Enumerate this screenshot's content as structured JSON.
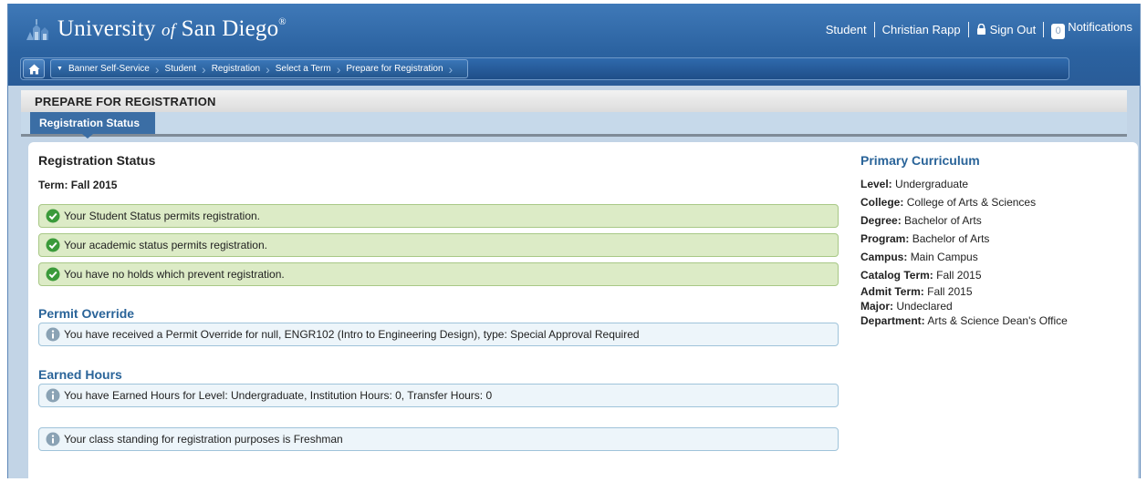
{
  "header": {
    "logo_prefix": "University",
    "logo_of": "of",
    "logo_suffix": "San Diego",
    "logo_reg": "®",
    "user_role": "Student",
    "user_name": "Christian Rapp",
    "sign_out": "Sign Out",
    "notifications_count": "0",
    "notifications_label": "Notifications"
  },
  "breadcrumbs": [
    "Banner Self-Service",
    "Student",
    "Registration",
    "Select a Term",
    "Prepare for Registration"
  ],
  "page": {
    "title": "PREPARE FOR REGISTRATION",
    "tab": "Registration Status"
  },
  "status": {
    "heading": "Registration Status",
    "term": "Term: Fall 2015",
    "messages": [
      "Your Student Status permits registration.",
      "Your academic status permits registration.",
      "You have no holds which prevent registration."
    ]
  },
  "permit": {
    "heading": "Permit Override",
    "message": "You have received a Permit Override for null, ENGR102 (Intro to Engineering Design), type: Special Approval Required"
  },
  "earned": {
    "heading": "Earned Hours",
    "message": "You have Earned Hours for Level: Undergraduate, Institution Hours: 0, Transfer Hours: 0",
    "standing": "Your class standing for registration purposes is Freshman"
  },
  "curriculum": {
    "heading": "Primary Curriculum",
    "rows": [
      {
        "label": "Level:",
        "value": "Undergraduate"
      },
      {
        "label": "College:",
        "value": "College of Arts & Sciences"
      },
      {
        "label": "Degree:",
        "value": "Bachelor of Arts"
      },
      {
        "label": "Program:",
        "value": "Bachelor of Arts"
      },
      {
        "label": "Campus:",
        "value": "Main Campus"
      },
      {
        "label": "Catalog Term:",
        "value": "Fall 2015"
      },
      {
        "label": "Admit Term:",
        "value": "Fall 2015"
      },
      {
        "label": "Major:",
        "value": "Undeclared"
      },
      {
        "label": "Department:",
        "value": "Arts & Science Dean's Office"
      }
    ]
  },
  "colors": {
    "header_blue": "#2b62a0",
    "success_bg": "#dcebc6",
    "success_icon": "#3a9a3a",
    "info_bg": "#edf5fa",
    "info_icon": "#8aa2b4",
    "section_blue": "#2a6499"
  }
}
